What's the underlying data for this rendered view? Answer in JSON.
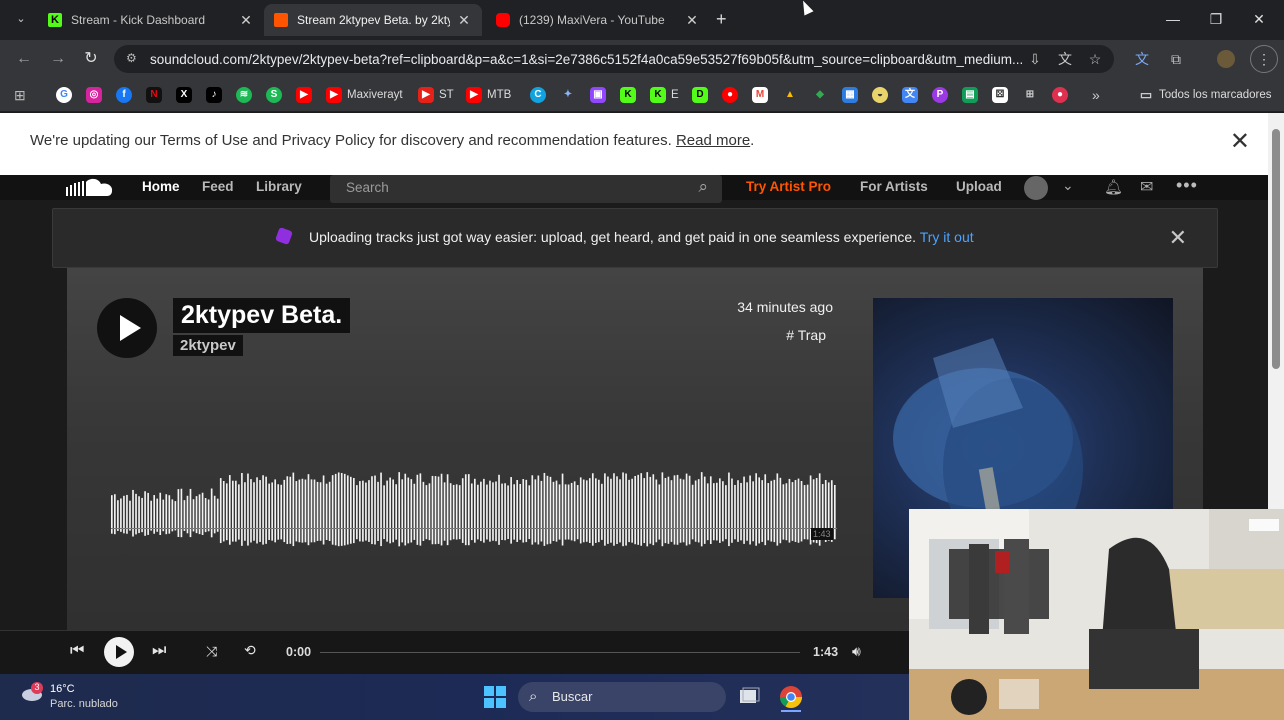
{
  "tabs": [
    {
      "title": "Stream - Kick Dashboard",
      "favicon_color": "#53fc18"
    },
    {
      "title": "Stream 2ktypev Beta. by 2ktype",
      "favicon_color": "#ff5500"
    },
    {
      "title": "(1239) MaxiVera - YouTube",
      "favicon_color": "#ff0000"
    }
  ],
  "new_tab_label": "+",
  "url": "soundcloud.com/2ktypev/2ktypev-beta?ref=clipboard&p=a&c=1&si=2e7386c5152f4a0ca59e53527f69b05f&utm_source=clipboard&utm_medium...",
  "bookmarks": [
    {
      "label": "Maxiverayt",
      "color": "#ff0000"
    },
    {
      "label": "ST",
      "color": "#e62117"
    },
    {
      "label": "MTB",
      "color": "#ff0000"
    },
    {
      "label": "E",
      "color": "#53fc18"
    }
  ],
  "all_bookmarks_label": "Todos los marcadores",
  "terms_banner": {
    "text": "We're updating our Terms of Use and Privacy Policy for discovery and recommendation features.",
    "link": "Read more",
    "period": "."
  },
  "sc_nav": {
    "home": "Home",
    "feed": "Feed",
    "library": "Library",
    "search_placeholder": "Search",
    "try_pro": "Try Artist Pro",
    "for_artists": "For Artists",
    "upload": "Upload"
  },
  "promo": {
    "text": "Uploading tracks just got way easier: upload, get heard, and get paid in one seamless experience.",
    "link": "Try it out"
  },
  "track": {
    "title": "2ktypev Beta.",
    "artist": "2ktypev",
    "posted": "34 minutes ago",
    "tag": "# Trap",
    "duration_label": "1:43"
  },
  "player": {
    "current_time": "0:00",
    "duration": "1:43",
    "progress": 0
  },
  "taskbar": {
    "temperature": "16°C",
    "condition": "Parc. nublado",
    "search_label": "Buscar",
    "weather_badge": "3"
  },
  "colors": {
    "sc_orange": "#ff5500",
    "link_blue": "#4ba3ff"
  }
}
